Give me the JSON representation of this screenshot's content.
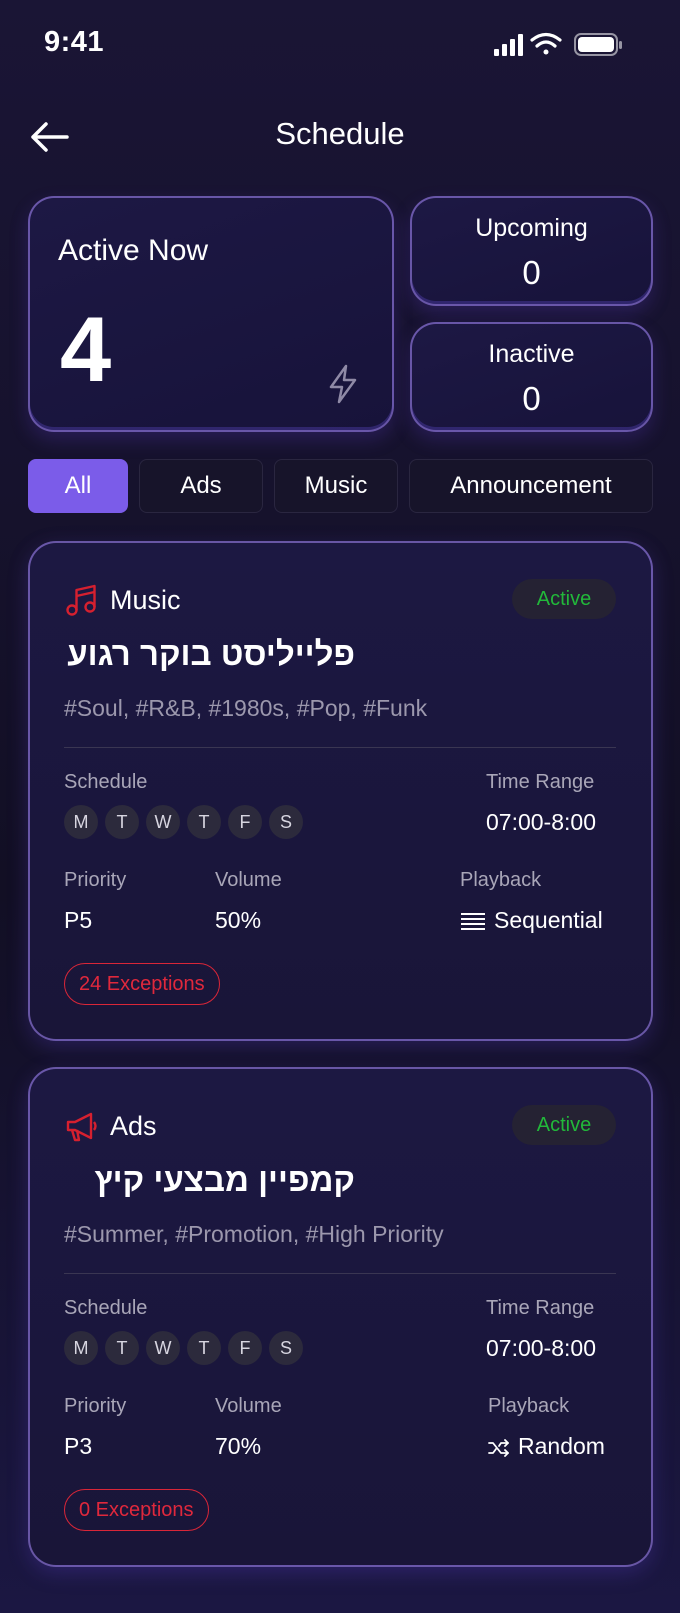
{
  "status_bar": {
    "time": "9:41"
  },
  "header": {
    "title": "Schedule"
  },
  "stats": {
    "active_label": "Active Now",
    "active_value": "4",
    "upcoming_label": "Upcoming",
    "upcoming_value": "0",
    "inactive_label": "Inactive",
    "inactive_value": "0"
  },
  "tabs": [
    {
      "label": "All",
      "selected": true
    },
    {
      "label": "Ads"
    },
    {
      "label": "Music"
    },
    {
      "label": "Announcement"
    }
  ],
  "schedules": [
    {
      "type": "Music",
      "type_icon": "music-note-icon",
      "status": "Active",
      "title": "פלייליסט בוקר רגוע",
      "tags": "#Soul, #R&B, #1980s, #Pop, #Funk",
      "schedule_label": "Schedule",
      "days": [
        "M",
        "T",
        "W",
        "T",
        "F",
        "S"
      ],
      "time_range_label": "Time Range",
      "time_range": "07:00-8:00",
      "priority_label": "Priority",
      "priority": "P5",
      "volume_label": "Volume",
      "volume": "50%",
      "playback_label": "Playback",
      "playback": "Sequential",
      "playback_icon": "list-icon",
      "exceptions": "24 Exceptions"
    },
    {
      "type": "Ads",
      "type_icon": "megaphone-icon",
      "status": "Active",
      "title": "קמפיין מבצעי קיץ",
      "tags": "#Summer, #Promotion, #High Priority",
      "schedule_label": "Schedule",
      "days": [
        "M",
        "T",
        "W",
        "T",
        "F",
        "S"
      ],
      "time_range_label": "Time Range",
      "time_range": "07:00-8:00",
      "priority_label": "Priority",
      "priority": "P3",
      "volume_label": "Volume",
      "volume": "70%",
      "playback_label": "Playback",
      "playback": "Random",
      "playback_icon": "shuffle-icon",
      "exceptions": "0 Exceptions"
    }
  ],
  "colors": {
    "accent": "#7b5ce9",
    "active_green": "#22b83a",
    "exception_red": "#e0283c",
    "music_icon_red": "#d6202f"
  }
}
